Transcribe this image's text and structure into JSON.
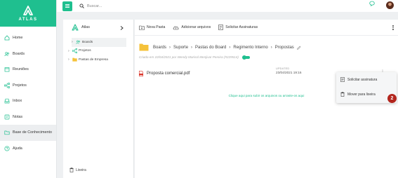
{
  "brand": {
    "name": "ATLAS",
    "accent": "#1fbf8f"
  },
  "topbar": {
    "search_placeholder": "Buscar..."
  },
  "nav": {
    "items": [
      {
        "label": "Home",
        "icon": "home-icon"
      },
      {
        "label": "Boards",
        "icon": "people-icon"
      },
      {
        "label": "Reuniões",
        "icon": "calendar-icon"
      },
      {
        "label": "Projetos",
        "icon": "hierarchy-icon"
      },
      {
        "label": "Inbox",
        "icon": "inbox-icon"
      },
      {
        "label": "Notas",
        "icon": "note-icon"
      },
      {
        "label": "Base de Conhecimento",
        "icon": "folder-icon"
      },
      {
        "label": "Ajuda",
        "icon": "help-icon"
      }
    ],
    "active_index": 6
  },
  "tree": {
    "title": "Atlas",
    "items": [
      {
        "label": "Boards",
        "icon": "people-icon"
      },
      {
        "label": "Projetos",
        "icon": "hierarchy-icon"
      },
      {
        "label": "Pastas de Empresa",
        "icon": "folder-icon"
      }
    ],
    "trash_label": "Lixeira"
  },
  "toolbar": {
    "new_folder": "Nova Pasta",
    "add_files": "Adicionar arquivos",
    "request_signatures": "Solicitar Assinaturas"
  },
  "breadcrumb": [
    "Boards",
    "Suporte",
    "Pastas do Board",
    "Regimento Interno",
    "Propostas"
  ],
  "created_info": "Criada em 10/04/2021 por Wendy Marisol Menjivar Pereira (#229514)",
  "columns": {
    "updated": "UPDATED"
  },
  "files": [
    {
      "name": "Proposta comercial.pdf",
      "date": "23/04/2021 19:16"
    }
  ],
  "upload_hint": "Clique aqui para subir os arquivos ou arraste-os aqui",
  "context_menu": {
    "items": [
      {
        "label": "Solicitar assinatura",
        "icon": "signature-icon"
      },
      {
        "label": "Mover para lixeira",
        "icon": "trash-icon"
      }
    ]
  },
  "badge": "2"
}
